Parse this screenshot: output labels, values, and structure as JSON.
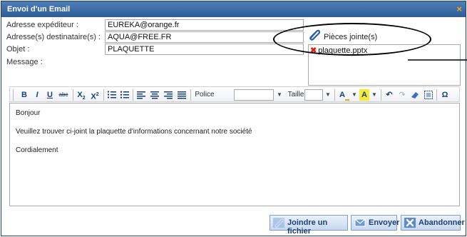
{
  "dialog": {
    "title": "Envoi d'un Email",
    "close_glyph": "×"
  },
  "form": {
    "sender_label": "Adresse expéditeur :",
    "sender_value": "EUREKA@orange.fr",
    "recipient_label": "Adresse(s) destinataire(s) :",
    "recipient_value": "AQUA@FREE.FR",
    "subject_label": "Objet :",
    "subject_value": "PLAQUETTE",
    "message_label": "Message :"
  },
  "attachments": {
    "title": "Pièces jointe(s)",
    "icon": "paperclip-icon",
    "files": [
      "plaquette.pptx"
    ],
    "delete_glyph": "✖"
  },
  "toolbar": {
    "bold": "B",
    "italic": "I",
    "underline": "U",
    "strike": "abc",
    "subscript_base": "X",
    "subscript_mark": "2",
    "superscript_base": "X",
    "superscript_mark": "2",
    "font_label": "Police",
    "size_label": "Taille",
    "source_glyph": "Ω"
  },
  "message": {
    "lines": [
      "Bonjour",
      "Veuillez trouver ci-joint la plaquette d'informations concernant notre société",
      "Cordialement"
    ]
  },
  "buttons": {
    "attach": "Joindre un fichier",
    "send": "Envoyer",
    "cancel": "Abandonner"
  },
  "colors": {
    "titlebar": "#2d5c98",
    "close": "#f7a21b",
    "button_text": "#1d3f78"
  }
}
